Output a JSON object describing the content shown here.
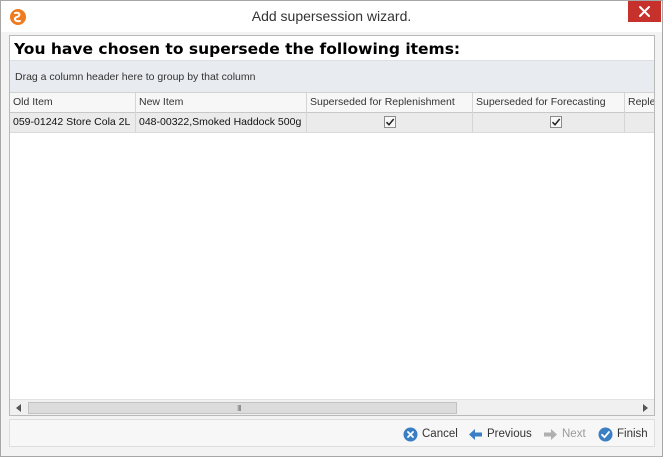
{
  "window": {
    "title": "Add supersession wizard."
  },
  "page": {
    "heading": "You have chosen to supersede the following items:",
    "group_hint": "Drag a column header here to group by that column"
  },
  "grid": {
    "columns": [
      "Old Item",
      "New Item",
      "Superseded for Replenishment",
      "Superseded for Forecasting",
      "Reple"
    ],
    "rows": [
      {
        "old_item": "059-01242 Store Cola 2L",
        "new_item": "048-00322,Smoked Haddock 500g",
        "superseded_for_replenishment": true,
        "superseded_for_forecasting": true
      }
    ],
    "scroll_grip": "III"
  },
  "footer": {
    "cancel_label": "Cancel",
    "previous_label": "Previous",
    "next_label": "Next",
    "finish_label": "Finish"
  },
  "colors": {
    "close_button": "#c7312b",
    "group_panel": "#e8ebef",
    "selected_row": "#ebebeb",
    "button_icon_blue": "#3a7fc4",
    "disabled_icon": "#b0b0b0",
    "app_icon_orange": "#f07a1e"
  },
  "icons": {
    "app": "app-logo-icon",
    "close": "close-icon",
    "cancel": "cancel-circle-icon",
    "previous": "arrow-left-icon",
    "next": "arrow-right-icon",
    "finish": "check-circle-icon"
  }
}
